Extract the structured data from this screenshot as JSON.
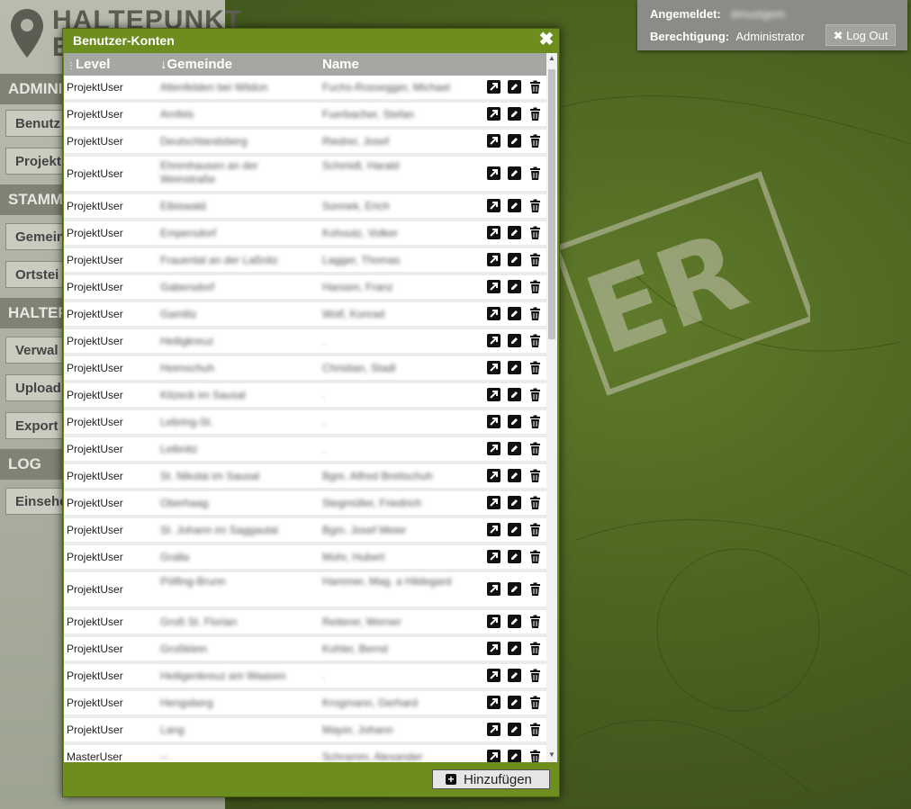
{
  "app": {
    "logo_line1": "HALTEPUNKT",
    "logo_line2": "E",
    "sections": [
      {
        "label": "ADMINI",
        "buttons": [
          "Benutz",
          "Projekt"
        ]
      },
      {
        "label": "STAMM",
        "buttons": [
          "Gemein",
          "Ortstei"
        ]
      },
      {
        "label": "HALTEP",
        "buttons": [
          "Verwal",
          "Upload",
          "Export"
        ]
      },
      {
        "label": "LOG",
        "buttons": [
          "Einsehe"
        ]
      }
    ]
  },
  "login": {
    "logged_in_label": "Angemeldet:",
    "logged_in_value": "dmustgem",
    "permission_label": "Berechtigung:",
    "permission_value": "Administrator",
    "logout_label": "Log Out"
  },
  "modal": {
    "title": "Benutzer-Konten",
    "columns": {
      "level": "Level",
      "gemeinde": "Gemeinde",
      "name": "Name"
    },
    "sort_indicator": "↓",
    "rows": [
      {
        "level": "ProjektUser",
        "gemeinde": "Altenfelden bei Wildon",
        "name": "Fuchs-Rossegger, Michael"
      },
      {
        "level": "ProjektUser",
        "gemeinde": "Arnfels",
        "name": "Fuerbacher, Stefan"
      },
      {
        "level": "ProjektUser",
        "gemeinde": "Deutschlandsberg",
        "name": "Riedrer, Josef"
      },
      {
        "level": "ProjektUser",
        "gemeinde": "Ehrenhausen an der Weinstraße",
        "name": "Schmidt, Harald"
      },
      {
        "level": "ProjektUser",
        "gemeinde": "Eibiswald",
        "name": "Sonnek, Erich"
      },
      {
        "level": "ProjektUser",
        "gemeinde": "Empersdorf",
        "name": "Kohoutz, Volker"
      },
      {
        "level": "ProjektUser",
        "gemeinde": "Frauental an der Laßnitz",
        "name": "Lagger, Thomas"
      },
      {
        "level": "ProjektUser",
        "gemeinde": "Gabersdorf",
        "name": "Hansen, Franz"
      },
      {
        "level": "ProjektUser",
        "gemeinde": "Gamlitz",
        "name": "Wolf, Konrad"
      },
      {
        "level": "ProjektUser",
        "gemeinde": "Heiligkreuz",
        "name": "."
      },
      {
        "level": "ProjektUser",
        "gemeinde": "Heimschuh",
        "name": "Christian, Stadl"
      },
      {
        "level": "ProjektUser",
        "gemeinde": "Kitzeck im Sausal",
        "name": "."
      },
      {
        "level": "ProjektUser",
        "gemeinde": "Lebring-St.",
        "name": "."
      },
      {
        "level": "ProjektUser",
        "gemeinde": "Leibnitz",
        "name": "."
      },
      {
        "level": "ProjektUser",
        "gemeinde": "St. Nikolai im Sausal",
        "name": "Bgm. Alfred Brettschuh"
      },
      {
        "level": "ProjektUser",
        "gemeinde": "Oberhaag",
        "name": "Stegmüller, Friedrich"
      },
      {
        "level": "ProjektUser",
        "gemeinde": "St. Johann im Saggautal",
        "name": "Bgm. Josef Meier"
      },
      {
        "level": "ProjektUser",
        "gemeinde": "Gralla",
        "name": "Mohr, Hubert"
      },
      {
        "level": "ProjektUser",
        "gemeinde": "Pölfing-Brunn",
        "name": "Hammer, Mag. a Hildegard"
      },
      {
        "level": "ProjektUser",
        "gemeinde": "Groß St. Florian",
        "name": "Reiterer, Werner"
      },
      {
        "level": "ProjektUser",
        "gemeinde": "Großklein",
        "name": "Kohler, Bernd"
      },
      {
        "level": "ProjektUser",
        "gemeinde": "Heiligenkreuz am Waasen",
        "name": "."
      },
      {
        "level": "ProjektUser",
        "gemeinde": "Hengsberg",
        "name": "Krogmann, Gerhard"
      },
      {
        "level": "ProjektUser",
        "gemeinde": "Lang",
        "name": "Mayer, Johann"
      },
      {
        "level": "MasterUser",
        "gemeinde": "--",
        "name": "Schramm, Alexander"
      }
    ],
    "add_button": "Hinzufügen"
  }
}
